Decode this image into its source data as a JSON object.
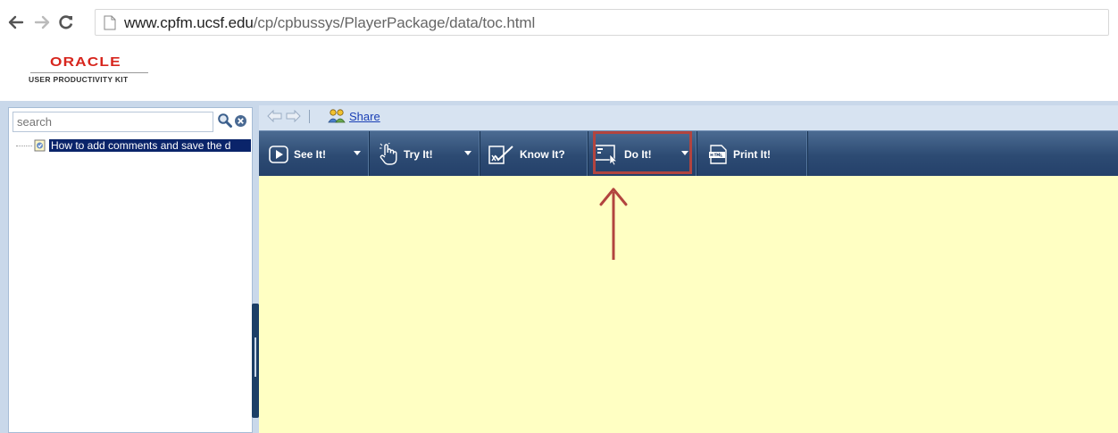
{
  "browser": {
    "url_host": "www.cpfm.ucsf.edu",
    "url_path": "/cp/cpbussys/PlayerPackage/data/toc.html"
  },
  "logo": {
    "brand": "ORACLE",
    "product": "USER PRODUCTIVITY KIT"
  },
  "sidebar": {
    "search_placeholder": "search",
    "toc_items": [
      {
        "label": "How to add comments and save the d"
      }
    ]
  },
  "toolbar": {
    "share_label": "Share",
    "modes": [
      {
        "label": "See It!",
        "icon": "play-icon",
        "has_dropdown": true
      },
      {
        "label": "Try It!",
        "icon": "hand-pointer-icon",
        "has_dropdown": true
      },
      {
        "label": "Know It?",
        "icon": "checklist-icon",
        "has_dropdown": false
      },
      {
        "label": "Do It!",
        "icon": "screen-cursor-icon",
        "has_dropdown": true,
        "highlighted": true
      },
      {
        "label": "Print It!",
        "icon": "html-doc-icon",
        "has_dropdown": false
      }
    ]
  },
  "colors": {
    "mode_bar": "#2d4b73",
    "content_bg": "#ffffc3",
    "highlight": "#b2443f",
    "oracle_red": "#d7261e"
  }
}
